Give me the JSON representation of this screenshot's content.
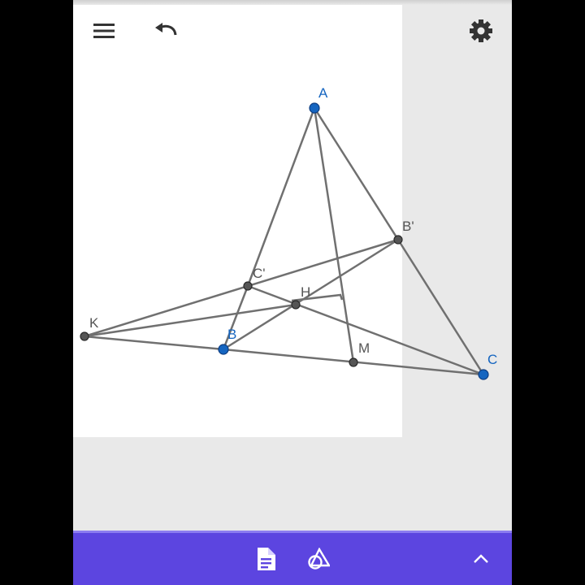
{
  "toolbar": {
    "menu_icon": "hamburger-menu-icon",
    "undo_icon": "undo-icon",
    "settings_icon": "gear-icon"
  },
  "construction": {
    "points": [
      {
        "id": "A",
        "label": "A",
        "kind": "free"
      },
      {
        "id": "B",
        "label": "B",
        "kind": "free"
      },
      {
        "id": "C",
        "label": "C",
        "kind": "free"
      },
      {
        "id": "B1",
        "label": "B'",
        "kind": "dependent"
      },
      {
        "id": "C1",
        "label": "C'",
        "kind": "dependent"
      },
      {
        "id": "H",
        "label": "H",
        "kind": "dependent"
      },
      {
        "id": "K",
        "label": "K",
        "kind": "dependent"
      },
      {
        "id": "M",
        "label": "M",
        "kind": "dependent"
      }
    ],
    "segments": [
      [
        "A",
        "C1"
      ],
      [
        "C1",
        "B"
      ],
      [
        "A",
        "B1"
      ],
      [
        "B1",
        "C"
      ],
      [
        "B",
        "C"
      ],
      [
        "A",
        "M"
      ],
      [
        "B",
        "B1"
      ],
      [
        "C1",
        "C"
      ],
      [
        "K",
        "B"
      ],
      [
        "K",
        "B1"
      ],
      [
        "K",
        "H"
      ]
    ]
  },
  "colors": {
    "free_point": "#1565c0",
    "dependent_point": "#555555",
    "free_label": "#1565c0",
    "dependent_label": "#555555",
    "segment": "#707070",
    "bottom_bar": "#5c45e0",
    "canvas_panel": "#ffffff",
    "background": "#e9e9e9"
  },
  "bottom_bar": {
    "algebra_icon": "document-icon",
    "tools_icon": "shapes-tool-icon",
    "expand_icon": "chevron-up-icon"
  }
}
